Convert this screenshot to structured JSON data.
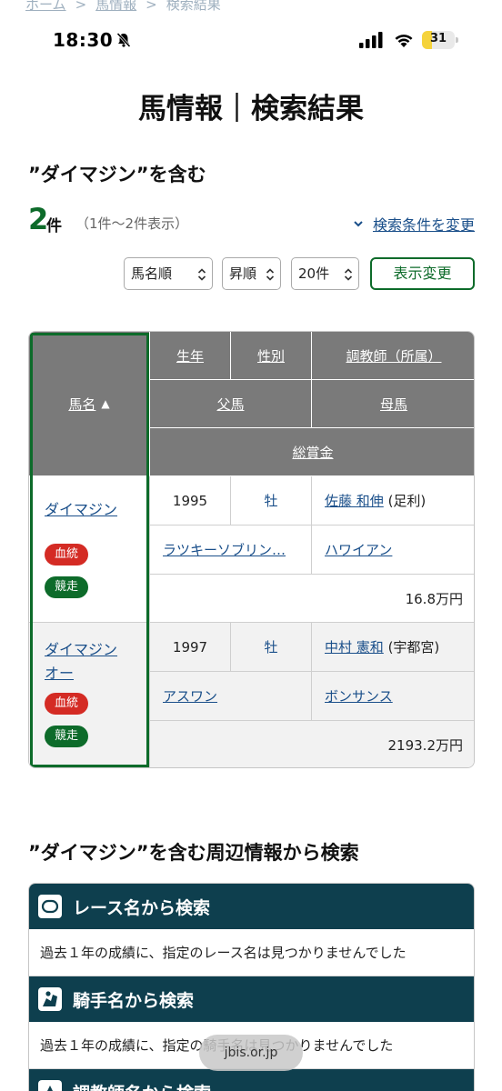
{
  "breadcrumb": {
    "home": "ホーム",
    "horse_info": "馬情報",
    "current": "検索結果",
    "separator": ">"
  },
  "status_bar": {
    "time": "18:30",
    "battery": "31",
    "battery_level": 0.31
  },
  "page": {
    "title": "馬情報｜検索結果"
  },
  "query": {
    "heading": "”ダイマジン”を含む"
  },
  "results_meta": {
    "count": "2",
    "count_unit": "件",
    "range": "（1件～2件表示）",
    "change_conditions": "検索条件を変更"
  },
  "controls": {
    "sort_by": "馬名順",
    "order": "昇順",
    "per_page": "20件",
    "apply": "表示変更"
  },
  "table": {
    "headers": {
      "name": "馬名",
      "birth_year": "生年",
      "sex": "性別",
      "trainer": "調教師（所属）",
      "sire": "父馬",
      "dam": "母馬",
      "earnings": "総賞金"
    },
    "rows": [
      {
        "name": "ダイマジン",
        "pedigree_badge": "血統",
        "race_badge": "競走",
        "birth_year": "1995",
        "sex": "牡",
        "trainer": "佐藤 和伸",
        "affiliation": "(足利)",
        "sire": "ラツキーソブリン…",
        "dam": "ハワイアン",
        "earnings": "16.8万円"
      },
      {
        "name_line1": "ダイマジン",
        "name_line2": "オー",
        "pedigree_badge": "血統",
        "race_badge": "競走",
        "birth_year": "1997",
        "sex": "牡",
        "trainer": "中村 憲和",
        "affiliation": "(宇都宮)",
        "sire": "アスワン",
        "dam": "ボンサンス",
        "earnings": "2193.2万円"
      }
    ]
  },
  "related": {
    "title": "”ダイマジン”を含む周辺情報から検索",
    "sections": [
      {
        "heading": "レース名から検索",
        "message": "過去１年の成績に、指定のレース名は見つかりませんでした"
      },
      {
        "heading": "騎手名から検索",
        "message": "過去１年の成績に、指定の騎手名は見つかりませんでした"
      },
      {
        "heading": "調教師名から検索"
      }
    ]
  },
  "browser": {
    "url": "jbis.or.jp"
  }
}
